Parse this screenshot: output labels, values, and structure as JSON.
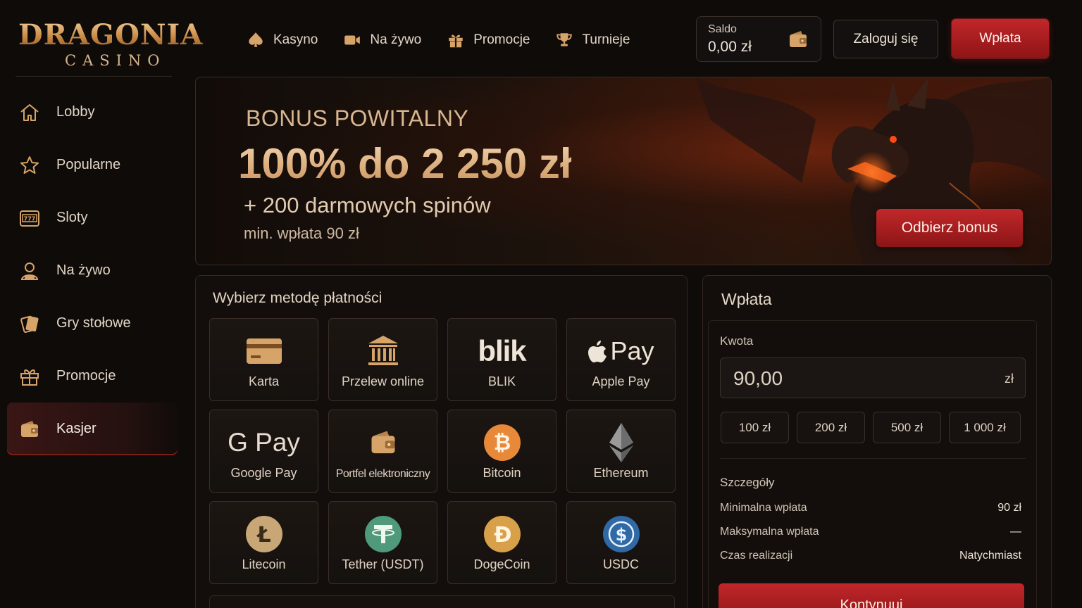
{
  "logo": {
    "main": "DRAGONIA",
    "sub": "CASINO"
  },
  "topnav": [
    {
      "label": "Kasyno",
      "icon": "spade-icon"
    },
    {
      "label": "Na żywo",
      "icon": "camera-icon"
    },
    {
      "label": "Promocje",
      "icon": "gift-icon"
    },
    {
      "label": "Turnieje",
      "icon": "trophy-icon"
    }
  ],
  "balance": {
    "label": "Saldo",
    "value": "0,00 zł",
    "icon": "wallet-icon"
  },
  "header": {
    "login_label": "Zaloguj się",
    "deposit_label": "Wpłata"
  },
  "sidebar": {
    "items": [
      {
        "label": "Lobby",
        "icon": "home-icon"
      },
      {
        "label": "Popularne",
        "icon": "star-icon"
      },
      {
        "label": "Sloty",
        "icon": "slot-machine-icon"
      },
      {
        "label": "Na żywo",
        "icon": "live-dealer-icon"
      },
      {
        "label": "Gry stołowe",
        "icon": "cards-icon"
      },
      {
        "label": "Promocje",
        "icon": "gift-icon"
      },
      {
        "label": "Kasjer",
        "icon": "wallet-icon",
        "active": true
      }
    ]
  },
  "banner": {
    "title": "BONUS POWITALNY",
    "headline": "100% do 2 250 zł",
    "spins": "+ 200 darmowych spinów",
    "min_deposit": "min. wpłata 90 zł",
    "cta": "Odbierz bonus"
  },
  "payment_methods": {
    "title": "Wybierz metodę płatności",
    "items": [
      {
        "label": "Karta",
        "icon": "card-icon"
      },
      {
        "label": "Przelew online",
        "icon": "bank-icon"
      },
      {
        "label": "BLIK",
        "icon": "blik-logo-icon",
        "logo_text": "blik"
      },
      {
        "label": "Apple Pay",
        "icon": "apple-pay-logo-icon",
        "logo_text": "Pay"
      },
      {
        "label": "Google Pay",
        "icon": "google-pay-logo-icon",
        "logo_text": "G Pay"
      },
      {
        "label": "Portfel elektroniczny",
        "icon": "wallet-icon"
      },
      {
        "label": "Bitcoin",
        "icon": "bitcoin-icon"
      },
      {
        "label": "Ethereum",
        "icon": "ethereum-icon"
      },
      {
        "label": "Litecoin",
        "icon": "litecoin-icon"
      },
      {
        "label": "Tether (USDT)",
        "icon": "tether-icon"
      },
      {
        "label": "DogeCoin",
        "icon": "dogecoin-icon"
      },
      {
        "label": "USDC",
        "icon": "usdc-icon"
      }
    ]
  },
  "deposit": {
    "title": "Wpłata",
    "amount_label": "Kwota",
    "amount_value": "90,00",
    "currency": "zł",
    "quick_amounts": [
      "100 zł",
      "200 zł",
      "500 zł",
      "1 000 zł"
    ],
    "details_title": "Szczegóły",
    "details": [
      {
        "label": "Minimalna wpłata",
        "value": "90 zł"
      },
      {
        "label": "Maksymalna wpłata",
        "value": "—"
      },
      {
        "label": "Czas realizacji",
        "value": "Natychmiast"
      }
    ],
    "continue_label": "Kontynuuj"
  },
  "colors": {
    "accent_red": "#b82326",
    "gold": "#d9a86a",
    "background": "#0f0b09"
  }
}
